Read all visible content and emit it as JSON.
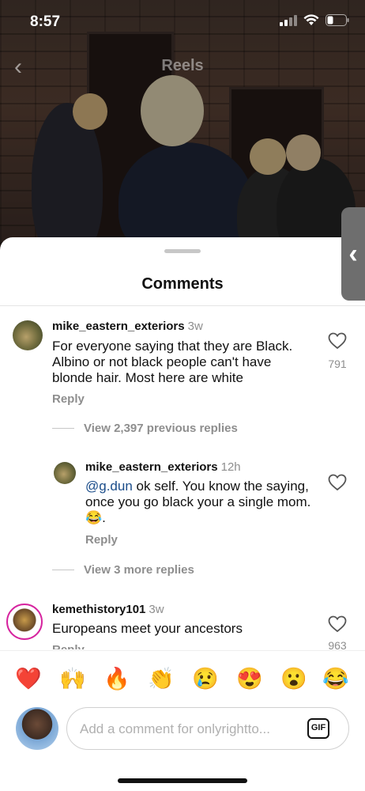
{
  "status_bar": {
    "time": "8:57"
  },
  "header": {
    "title": "Reels"
  },
  "sheet": {
    "title": "Comments"
  },
  "comments": [
    {
      "username": "mike_eastern_exteriors",
      "timestamp": "3w",
      "text": "For everyone saying that they are Black. Albino or not black people can't have blonde hair. Most here are white",
      "likes": "791",
      "reply_label": "Reply",
      "view_replies": "View 2,397 previous replies"
    },
    {
      "username": "mike_eastern_exteriors",
      "timestamp": "12h",
      "mention": "@g.dun",
      "text": " ok self. You know the saying, once you go black your a single mom. 😂.",
      "reply_label": "Reply",
      "view_replies": "View 3 more replies"
    },
    {
      "username": "kemethistory101",
      "timestamp": "3w",
      "text": "Europeans meet your ancestors",
      "likes": "963",
      "reply_label": "Reply"
    }
  ],
  "emoji_bar": [
    "❤️",
    "🙌",
    "🔥",
    "👏",
    "😢",
    "😍",
    "😮",
    "😂"
  ],
  "composer": {
    "placeholder": "Add a comment for onlyrightto...",
    "gif_label": "GIF"
  },
  "colors": {
    "mention": "#1b4d8a",
    "muted": "#8e8e8e"
  }
}
